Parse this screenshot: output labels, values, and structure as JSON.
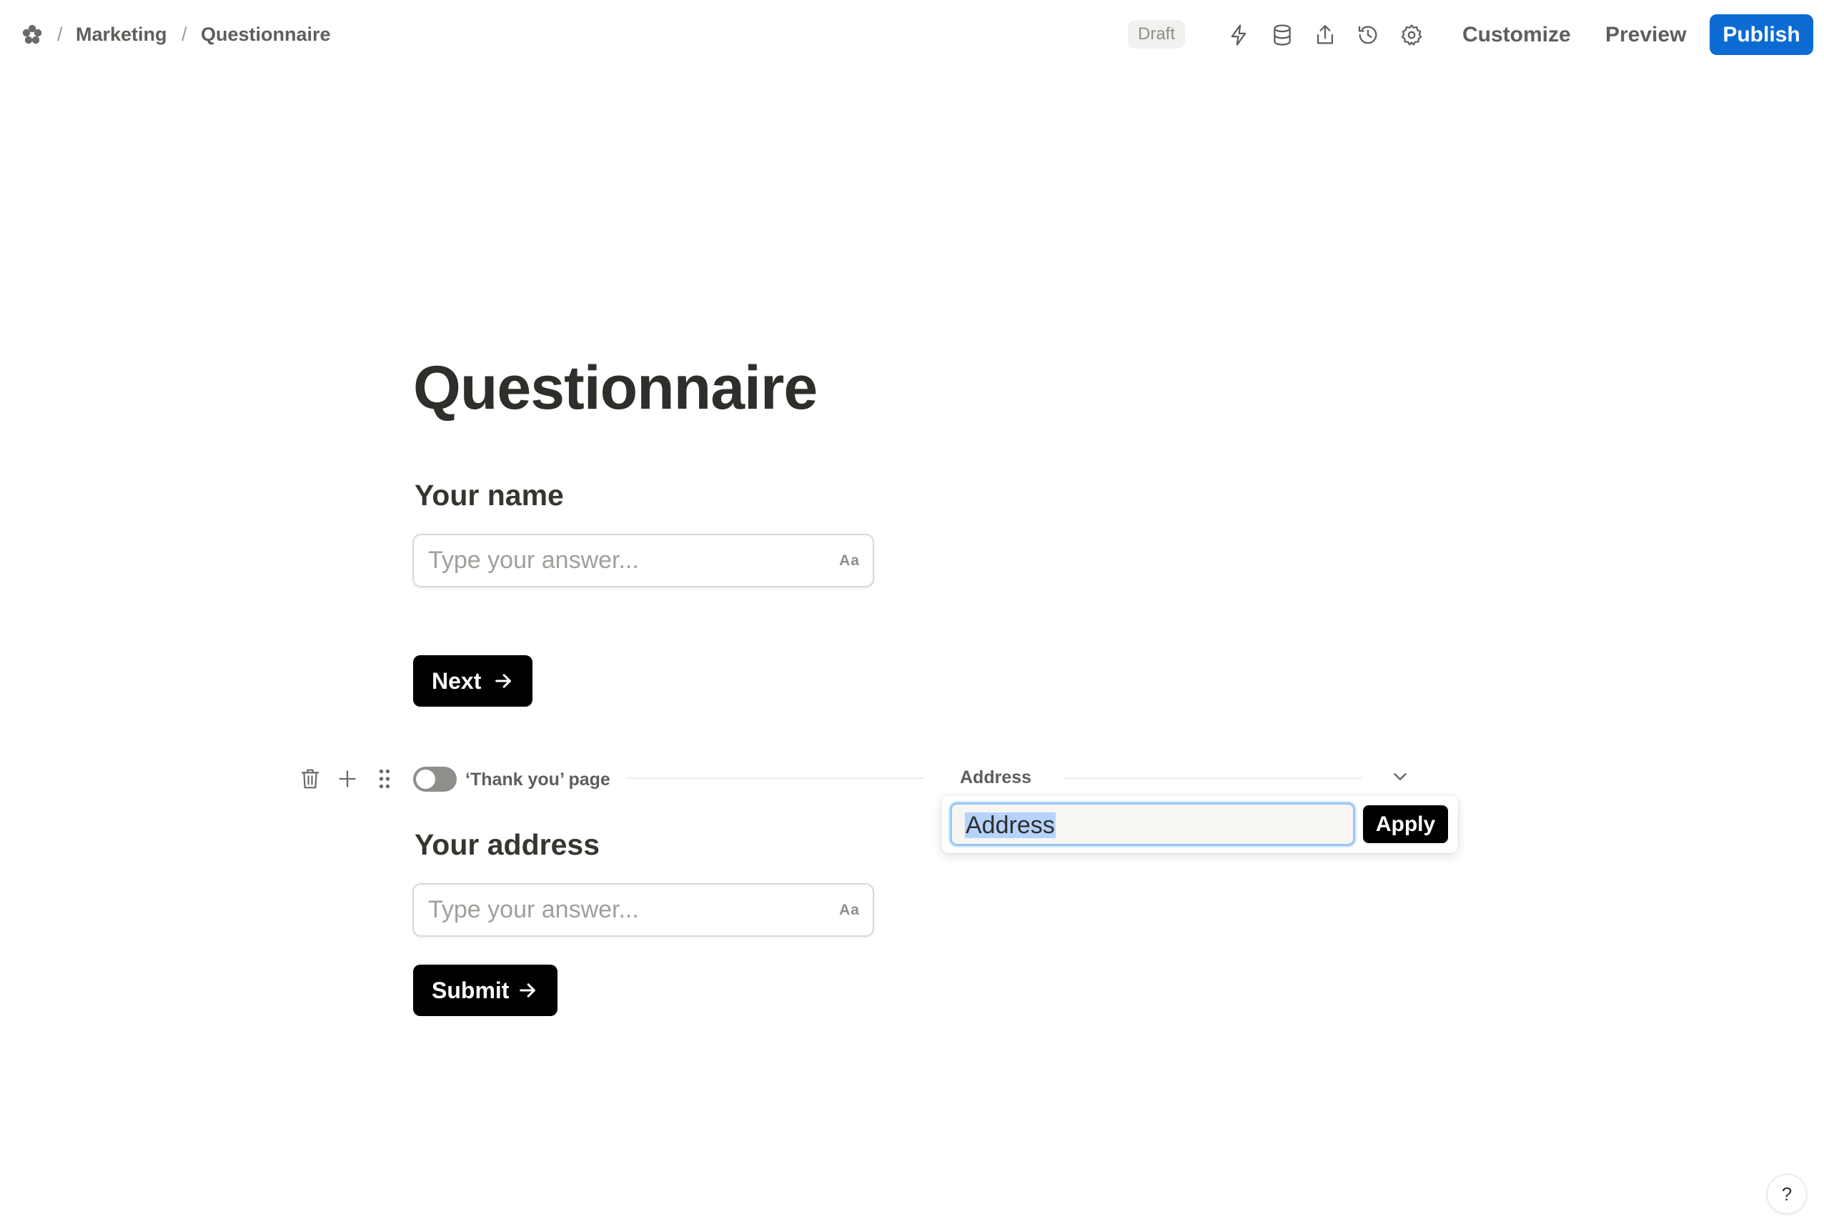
{
  "header": {
    "breadcrumb": [
      "Marketing",
      "Questionnaire"
    ],
    "separator": "/",
    "status_badge": "Draft",
    "icons": [
      "lightning-icon",
      "database-icon",
      "share-icon",
      "history-icon",
      "settings-icon"
    ],
    "customize_label": "Customize",
    "preview_label": "Preview",
    "publish_label": "Publish",
    "publish_color": "#0b6bd3"
  },
  "form": {
    "title": "Questionnaire",
    "questions": [
      {
        "label": "Your name",
        "placeholder": "Type your answer...",
        "type_icon": "Aa"
      },
      {
        "label": "Your address",
        "placeholder": "Type your answer...",
        "type_icon": "Aa"
      }
    ],
    "next_label": "Next",
    "submit_label": "Submit"
  },
  "block_toolbar": {
    "icons": [
      "trash-icon",
      "plus-icon",
      "drag-handle-icon"
    ],
    "thank_you_toggle_on": false,
    "thank_you_label": "‘Thank you’ page",
    "branch_label": "Address"
  },
  "rename_popover": {
    "value": "Address",
    "apply_label": "Apply"
  },
  "help_label": "?"
}
